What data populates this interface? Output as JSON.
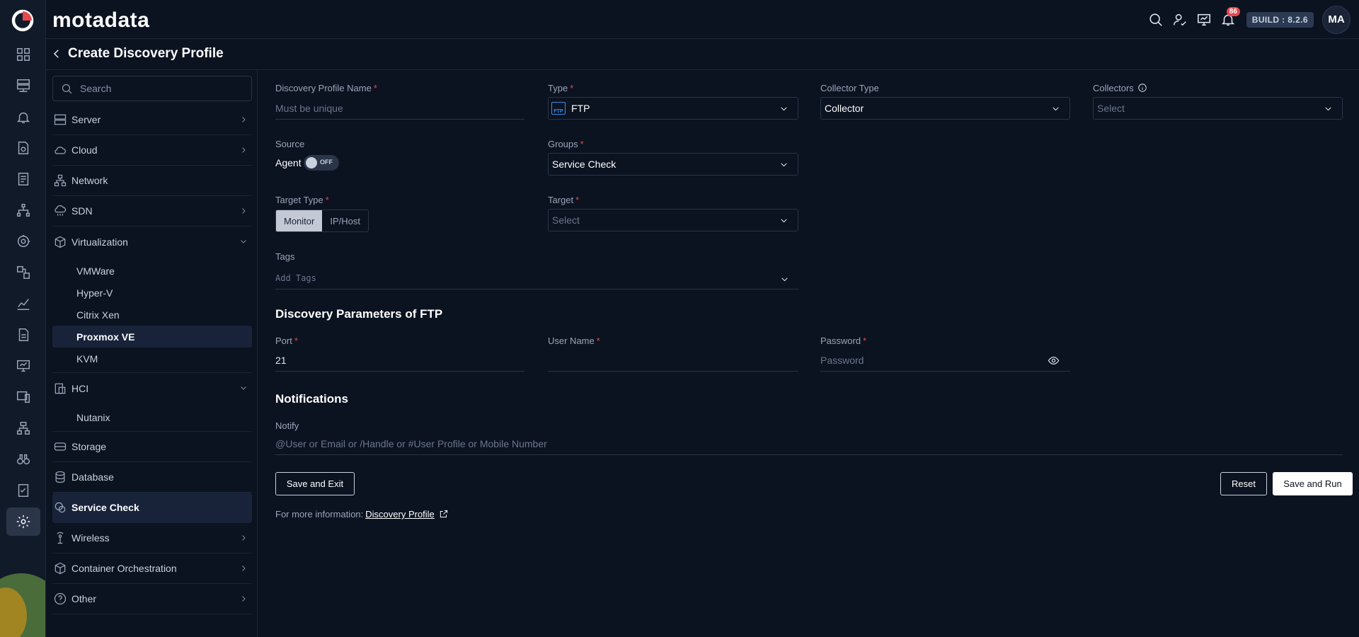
{
  "app": {
    "brand": "motadata",
    "build": "BUILD : 8.2.6",
    "notifications_count": "86",
    "user_initials": "MA"
  },
  "header": {
    "icons": [
      "search-icon",
      "user-check-icon",
      "monitor-icon",
      "bell-icon"
    ]
  },
  "rail": {
    "items": [
      "dashboard-icon",
      "server-icon",
      "alert-bell-icon",
      "compliance-icon",
      "report-icon",
      "topology-icon",
      "discovery-icon",
      "flow-icon",
      "metric-explorer-icon",
      "document-icon",
      "desktop-icon",
      "device-icon",
      "network-diagram-icon",
      "binoculars-icon",
      "checklist-icon",
      "settings-icon"
    ],
    "active": "settings-icon"
  },
  "page": {
    "title": "Create Discovery Profile"
  },
  "sidebar": {
    "search_placeholder": "Search",
    "categories": [
      {
        "label": "Server",
        "icon": "server-icon",
        "expandable": true
      },
      {
        "label": "Cloud",
        "icon": "cloud-icon",
        "expandable": true
      },
      {
        "label": "Network",
        "icon": "network-icon",
        "expandable": false
      },
      {
        "label": "SDN",
        "icon": "sdn-icon",
        "expandable": true
      },
      {
        "label": "Virtualization",
        "icon": "cube-icon",
        "expandable": true,
        "expanded": true
      },
      {
        "label": "HCI",
        "icon": "hci-icon",
        "expandable": true,
        "expanded": true
      },
      {
        "label": "Storage",
        "icon": "storage-icon",
        "expandable": false
      },
      {
        "label": "Database",
        "icon": "database-icon",
        "expandable": false
      },
      {
        "label": "Service Check",
        "icon": "service-check-icon",
        "expandable": false,
        "active": true
      },
      {
        "label": "Wireless",
        "icon": "wireless-icon",
        "expandable": true
      },
      {
        "label": "Container Orchestration",
        "icon": "container-icon",
        "expandable": true
      },
      {
        "label": "Other",
        "icon": "question-icon",
        "expandable": true
      }
    ],
    "virtualization_items": [
      "VMWare",
      "Hyper-V",
      "Citrix Xen",
      "Proxmox VE",
      "KVM"
    ],
    "virtualization_active": "Proxmox VE",
    "hci_items": [
      "Nutanix"
    ]
  },
  "form": {
    "profile_name": {
      "label": "Discovery Profile Name",
      "placeholder": "Must be unique",
      "value": ""
    },
    "type": {
      "label": "Type",
      "value": "FTP",
      "icon_text": "FTP"
    },
    "collector_type": {
      "label": "Collector Type",
      "value": "Collector"
    },
    "collectors": {
      "label": "Collectors",
      "placeholder": "Select"
    },
    "source": {
      "label": "Source",
      "agent_label": "Agent",
      "toggle_state": "OFF"
    },
    "groups": {
      "label": "Groups",
      "value": "Service Check"
    },
    "target_type": {
      "label": "Target Type",
      "options": [
        "Monitor",
        "IP/Host"
      ],
      "selected": "Monitor"
    },
    "target": {
      "label": "Target",
      "placeholder": "Select"
    },
    "tags": {
      "label": "Tags",
      "placeholder": "Add Tags"
    },
    "params_title": "Discovery Parameters of FTP",
    "port": {
      "label": "Port",
      "value": "21"
    },
    "user_name": {
      "label": "User Name",
      "value": ""
    },
    "password": {
      "label": "Password",
      "placeholder": "Password"
    },
    "notifications_title": "Notifications",
    "notify": {
      "label": "Notify",
      "placeholder": "@User or Email or /Handle or #User Profile or Mobile Number"
    },
    "buttons": {
      "save_exit": "Save and Exit",
      "reset": "Reset",
      "save_run": "Save and Run"
    },
    "more_info": {
      "text": "For more information:",
      "link": "Discovery Profile"
    }
  },
  "colors": {
    "background": "#0b1220",
    "required": "#e5484d",
    "accent": "#3b8eea",
    "badge": "#e5484d"
  }
}
